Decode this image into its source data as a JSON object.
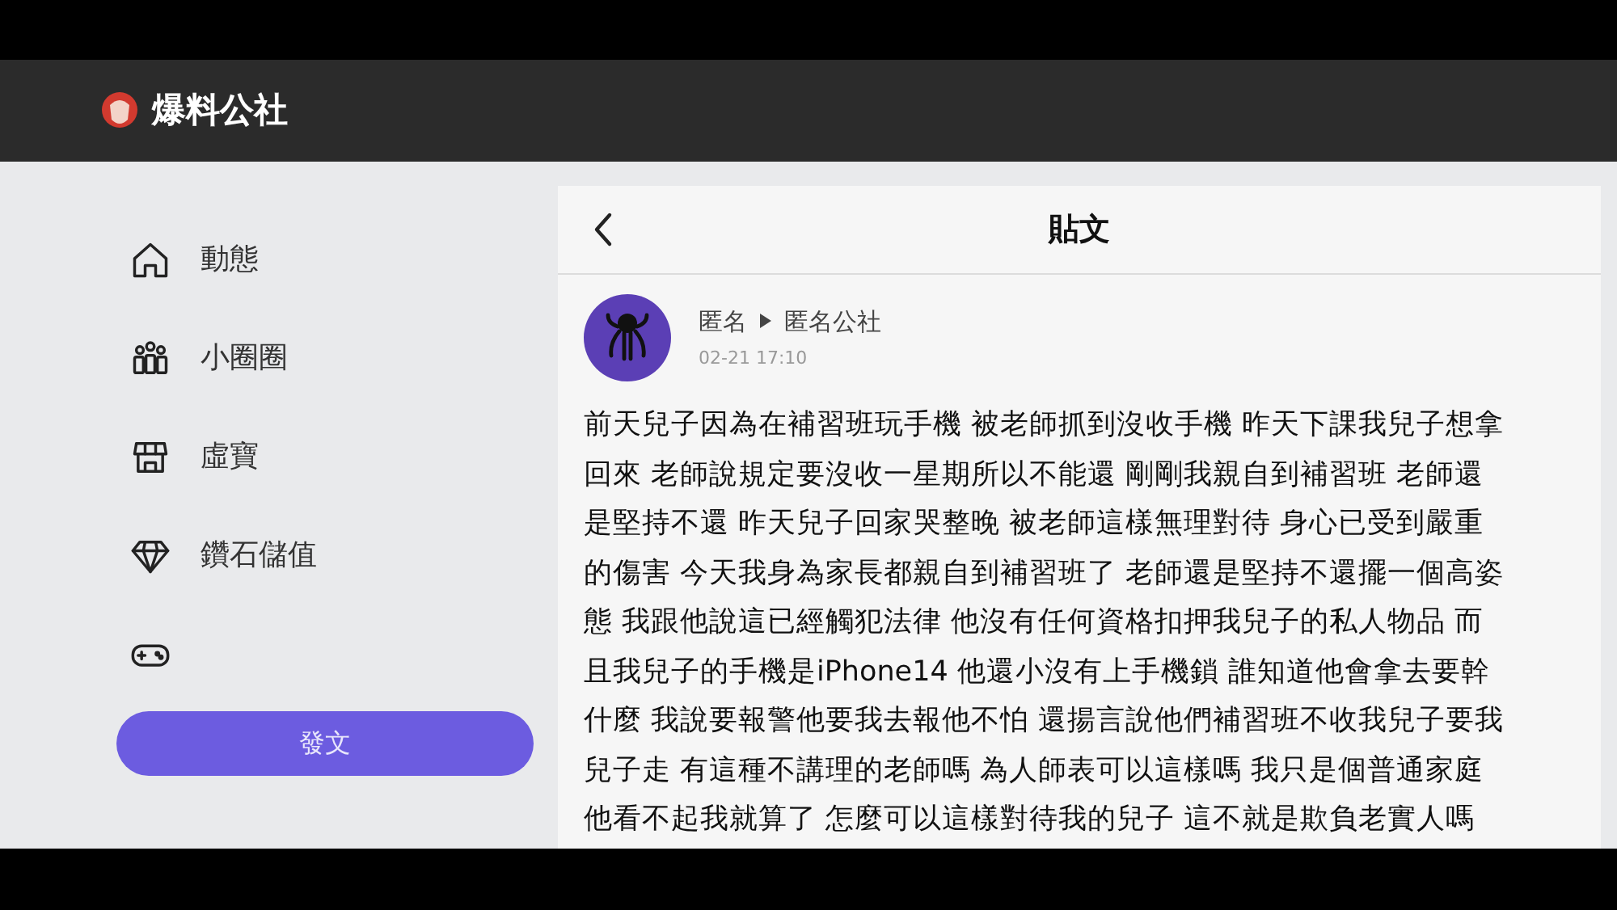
{
  "header": {
    "site_name": "爆料公社"
  },
  "sidebar": {
    "items": [
      {
        "kind": "home",
        "label": "動態"
      },
      {
        "kind": "groups",
        "label": "小圈圈"
      },
      {
        "kind": "shop",
        "label": "虛寶"
      },
      {
        "kind": "diamond",
        "label": "鑽石儲值"
      },
      {
        "kind": "gamepad"
      }
    ],
    "post_button": "發文"
  },
  "post": {
    "title": "貼文",
    "author": "匿名",
    "board": "匿名公社",
    "time": "02-21 17:10",
    "body_lines": [
      "前天兒子因為在補習班玩手機 被老師抓到沒收手機 昨天下課我兒子想拿",
      "回來 老師說規定要沒收一星期所以不能還 剛剛我親自到補習班 老師還",
      "是堅持不還 昨天兒子回家哭整晚 被老師這樣無理對待 身心已受到嚴重",
      "的傷害 今天我身為家長都親自到補習班了 老師還是堅持不還擺一個高姿",
      "態 我跟他說這已經觸犯法律 他沒有任何資格扣押我兒子的私人物品 而",
      "且我兒子的手機是iPhone14 他還小沒有上手機鎖 誰知道他會拿去要幹",
      "什麼 我說要報警他要我去報他不怕 還揚言說他們補習班不收我兒子要我",
      "兒子走 有這種不講理的老師嗎 為人師表可以這樣嗎 我只是個普通家庭",
      "他看不起我就算了 怎麼可以這樣對待我的兒子 這不就是欺負老實人嗎"
    ]
  }
}
